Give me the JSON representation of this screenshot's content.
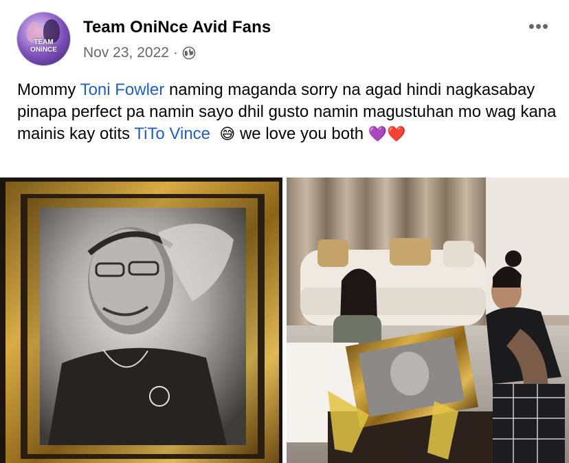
{
  "post": {
    "author": "Team OniNce Avid Fans",
    "avatar_text_1": "TEAM",
    "avatar_text_2": "ONiNCE",
    "date": "Nov 23, 2022",
    "separator": "·",
    "privacy_icon": "globe-icon",
    "more_icon": "more-options-icon",
    "more_label": "•••",
    "caption": {
      "part1": "Mommy ",
      "mention1": "Toni Fowler",
      "part2": " naming maganda sorry na agad hindi nagkasabay pinapa perfect pa namin sayo dhil gusto namin magustuhan mo wag kana mainis kay otits ",
      "mention2": "TiTo Vince",
      "emoji1": "😅",
      "part3": " we love you both ",
      "emoji2": "💜",
      "emoji3": "❤️"
    },
    "photos": [
      {
        "name": "framed-portrait-photo",
        "description_icon": "portrait-icon"
      },
      {
        "name": "gift-reveal-photo",
        "description_icon": "photo-icon"
      }
    ]
  },
  "colors": {
    "mention": "#1f5fbf",
    "meta_text": "#65676b",
    "frame_gold": "#c9992f"
  }
}
